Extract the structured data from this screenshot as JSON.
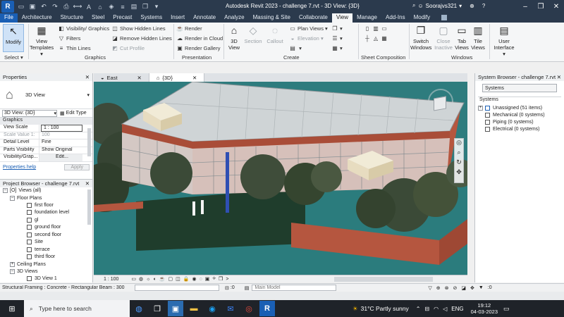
{
  "titlebar": {
    "app_logo": "R",
    "window_title": "Autodesk Revit 2023 - challenge 7.rvt - 3D View: {3D}",
    "user": "Soorajvs321"
  },
  "menu": {
    "tabs": [
      "File",
      "Architecture",
      "Structure",
      "Steel",
      "Precast",
      "Systems",
      "Insert",
      "Annotate",
      "Analyze",
      "Massing & Site",
      "Collaborate",
      "View",
      "Manage",
      "Add-Ins",
      "Modify"
    ],
    "active": "View"
  },
  "ribbon": {
    "modify": "Modify",
    "view_templates": "View Templates",
    "visibility_graphics": "Visibility/ Graphics",
    "filters": "Filters",
    "thin_lines": "Thin Lines",
    "show_hidden_lines": "Show Hidden Lines",
    "remove_hidden_lines": "Remove Hidden Lines",
    "cut_profile": "Cut Profile",
    "render": "Render",
    "render_in_cloud": "Render in Cloud",
    "render_gallery": "Render Gallery",
    "view_3d": "3D View",
    "section": "Section",
    "callout": "Callout",
    "plan_views": "Plan Views",
    "elevation": "Elevation",
    "switch_windows": "Switch Windows",
    "close_inactive": "Close Inactive",
    "tab_views": "Tab Views",
    "tile_views": "Tile Views",
    "user_interface": "User Interface",
    "panels": [
      "Select",
      "Graphics",
      "Presentation",
      "Create",
      "Sheet Composition",
      "Windows"
    ]
  },
  "properties": {
    "title": "Properties",
    "type_name": "3D View",
    "selector": "3D View: {3D}",
    "edit_type": "Edit Type",
    "section": "Graphics",
    "rows": [
      {
        "k": "View Scale",
        "v": "1 : 100"
      },
      {
        "k": "Scale Value 1:",
        "v": "100"
      },
      {
        "k": "Detail Level",
        "v": "Fine"
      },
      {
        "k": "Parts Visibility",
        "v": "Show Original"
      },
      {
        "k": "Visibility/Grap...",
        "v": "Edit..."
      }
    ],
    "help": "Properties help",
    "apply": "Apply"
  },
  "browser": {
    "title": "Project Browser - challenge 7.rvt",
    "views_all": "Views (all)",
    "floor_plans": "Floor Plans",
    "plans": [
      "first floor",
      "foundation level",
      "gl",
      "ground floor",
      "second floor",
      "Site",
      "terrace",
      "third floor"
    ],
    "ceiling_plans": "Ceiling Plans",
    "views_3d": "3D Views",
    "view_3d_1": "3D View 1"
  },
  "viewtabs": {
    "east": "East",
    "active": "{3D}"
  },
  "viewbar": {
    "scale": "1 : 100"
  },
  "system_browser": {
    "title": "System Browser - challenge 7.rvt",
    "dropdown": "Systems",
    "column": "Systems",
    "items": [
      "Unassigned (51 items)",
      "Mechanical (0 systems)",
      "Piping (0 systems)",
      "Electrical (0 systems)"
    ]
  },
  "statusbar": {
    "message": "Structural Framing : Concrete - Rectangular Beam : 300",
    "count": ":0",
    "model": "Main Model"
  },
  "taskbar": {
    "search": "Type here to search",
    "weather": "31°C  Partly sunny",
    "lang": "ENG",
    "time": "19:12",
    "date": "04-03-2023"
  },
  "colors": {
    "background": "#2e7c7e",
    "brick": "#b5563f",
    "roof": "#cfd4d6",
    "accent": "#1a5fb4"
  }
}
